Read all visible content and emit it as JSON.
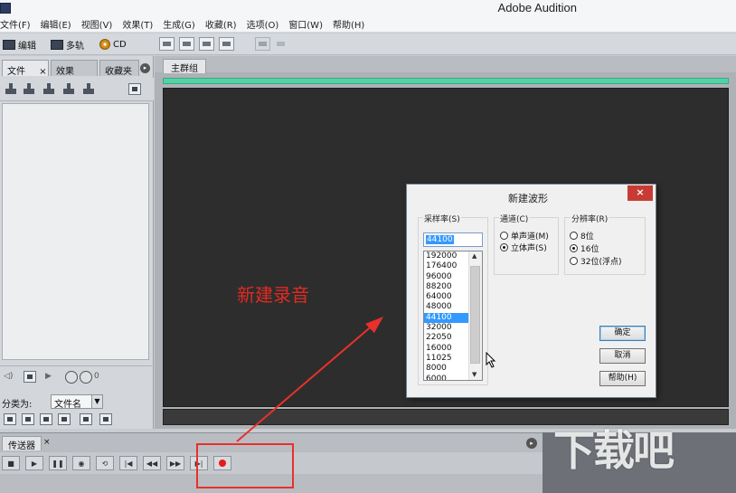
{
  "window": {
    "title": "Adobe Audition"
  },
  "menu": [
    "文件(F)",
    "编辑(E)",
    "视图(V)",
    "效果(T)",
    "生成(G)",
    "收藏(R)",
    "选项(O)",
    "窗口(W)",
    "帮助(H)"
  ],
  "toolbar": {
    "edit_label": "编辑",
    "multitrack_label": "多轨",
    "cd_label": "CD"
  },
  "left_panel": {
    "tabs": [
      "文件",
      "效果",
      "收藏夹"
    ],
    "tab_close": "×",
    "sort_label": "分类为:",
    "sort_value": "文件名",
    "counter": "0"
  },
  "main": {
    "tab": "主群组"
  },
  "transport": {
    "tab": "传送器",
    "close": "×"
  },
  "dialog": {
    "title": "新建波形",
    "close": "×",
    "sample_rate": {
      "label": "采样率(S)",
      "value": "44100",
      "options": [
        "192000",
        "176400",
        "96000",
        "88200",
        "64000",
        "48000",
        "44100",
        "32000",
        "22050",
        "16000",
        "11025",
        "8000",
        "6000"
      ],
      "selected": "44100"
    },
    "channels": {
      "label": "通道(C)",
      "options": [
        "单声道(M)",
        "立体声(S)"
      ],
      "selected": "立体声(S)"
    },
    "resolution": {
      "label": "分辨率(R)",
      "options": [
        "8位",
        "16位",
        "32位(浮点)"
      ],
      "selected": "16位"
    },
    "buttons": {
      "ok": "确定",
      "cancel": "取消",
      "help": "帮助(H)"
    }
  },
  "annotation": {
    "text": "新建录音",
    "color": "#e12a23"
  },
  "watermark": "下载吧"
}
